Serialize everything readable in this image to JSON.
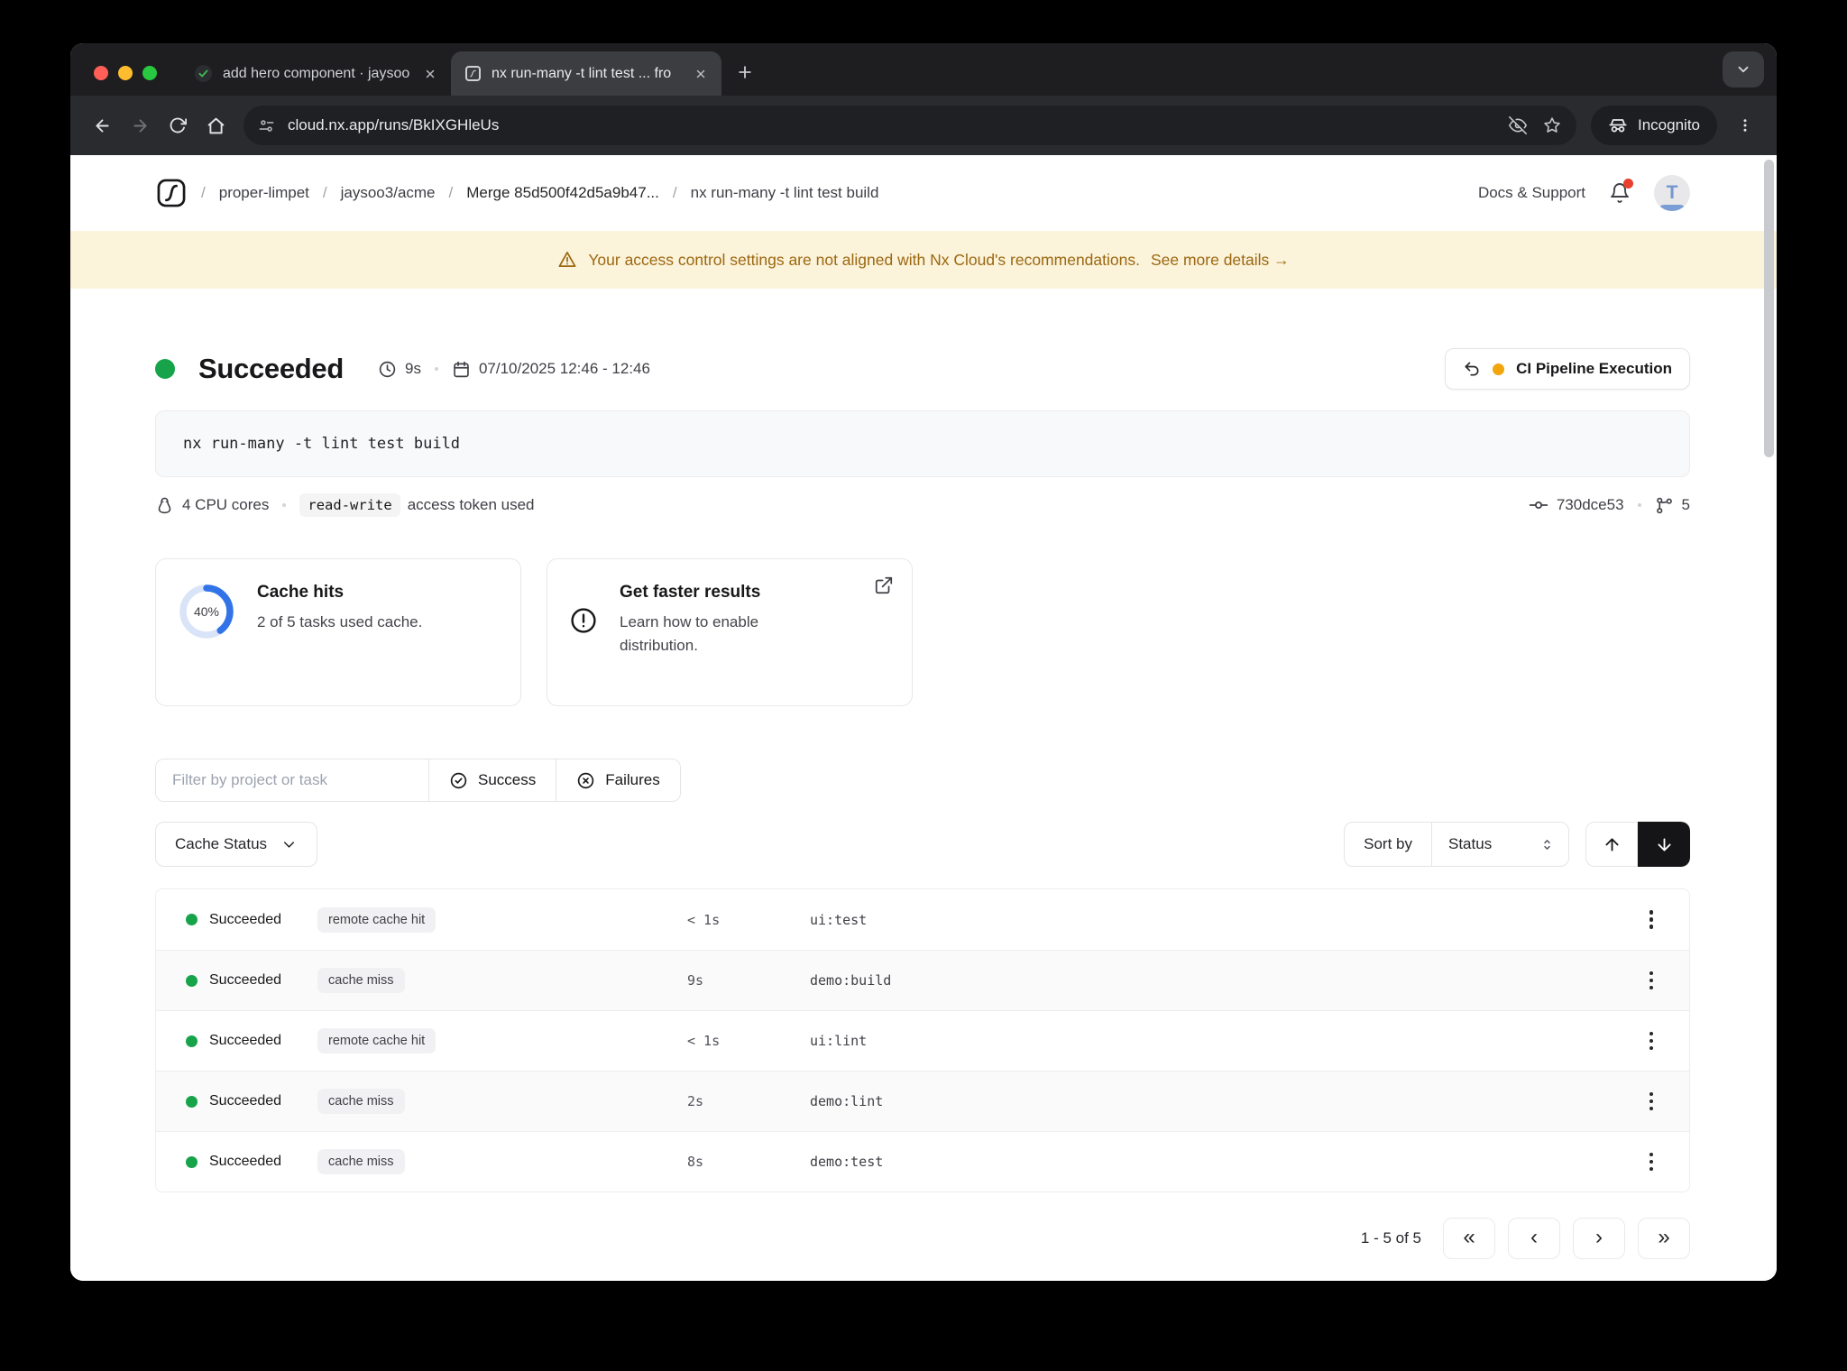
{
  "browser": {
    "tabs": [
      {
        "title": "add hero component · jaysoo",
        "favicon": "github-check-icon",
        "active": false
      },
      {
        "title": "nx run-many -t lint test ... fro",
        "favicon": "nx-icon",
        "active": true
      }
    ],
    "url": "cloud.nx.app/runs/BkIXGHleUs",
    "incognito_label": "Incognito"
  },
  "header": {
    "breadcrumbs": [
      "proper-limpet",
      "jaysoo3/acme",
      "Merge 85d500f42d5a9b47...",
      "nx run-many -t lint test build"
    ],
    "docs_support": "Docs & Support",
    "avatar_letter": "T"
  },
  "banner": {
    "message": "Your access control settings are not aligned with Nx Cloud's recommendations.",
    "link": "See more details →"
  },
  "run": {
    "status": "Succeeded",
    "duration": "9s",
    "date_range": "07/10/2025 12:46 - 12:46",
    "pipeline_button": "CI Pipeline Execution",
    "command": "nx run-many -t lint test build",
    "cpu": "4 CPU cores",
    "token_chip": "read-write",
    "token_suffix": "access token used",
    "commit": "730dce53",
    "branch_count": "5"
  },
  "cards": {
    "cache": {
      "percent": "40%",
      "title": "Cache hits",
      "subtitle": "2 of 5 tasks used cache."
    },
    "faster": {
      "title": "Get faster results",
      "subtitle": "Learn how to enable distribution."
    }
  },
  "filters": {
    "placeholder": "Filter by project or task",
    "success": "Success",
    "failures": "Failures",
    "cache_status": "Cache Status",
    "sort_by": "Sort by",
    "sort_value": "Status"
  },
  "table": {
    "rows": [
      {
        "status": "Succeeded",
        "cache": "remote cache hit",
        "duration": "< 1s",
        "task": "ui:test"
      },
      {
        "status": "Succeeded",
        "cache": "cache miss",
        "duration": "9s",
        "task": "demo:build"
      },
      {
        "status": "Succeeded",
        "cache": "remote cache hit",
        "duration": "< 1s",
        "task": "ui:lint"
      },
      {
        "status": "Succeeded",
        "cache": "cache miss",
        "duration": "2s",
        "task": "demo:lint"
      },
      {
        "status": "Succeeded",
        "cache": "cache miss",
        "duration": "8s",
        "task": "demo:test"
      }
    ]
  },
  "pagination": {
    "label": "1 - 5 of 5",
    "first": "«",
    "prev": "‹",
    "next": "›",
    "last": "»"
  },
  "icons": {
    "warning-icon": "⚠",
    "clock-icon": "🕐",
    "calendar-icon": "📅",
    "bell-icon": "🔔",
    "linux-penguin-icon": "🐧",
    "commit-icon": "-o-",
    "branch-icon": "git-branch",
    "undo-icon": "↶",
    "external-link-icon": "↗",
    "info-icon": "(!)",
    "kebab-icon": "⋮"
  },
  "colors": {
    "accent_blue": "#3373e8",
    "donut_track": "#d9e4f8",
    "success_green": "#16a34a",
    "warning_text": "#9c6812",
    "banner_bg": "#fbf3da",
    "pending_yellow": "#f2a50c",
    "danger_red": "#e8402f"
  }
}
